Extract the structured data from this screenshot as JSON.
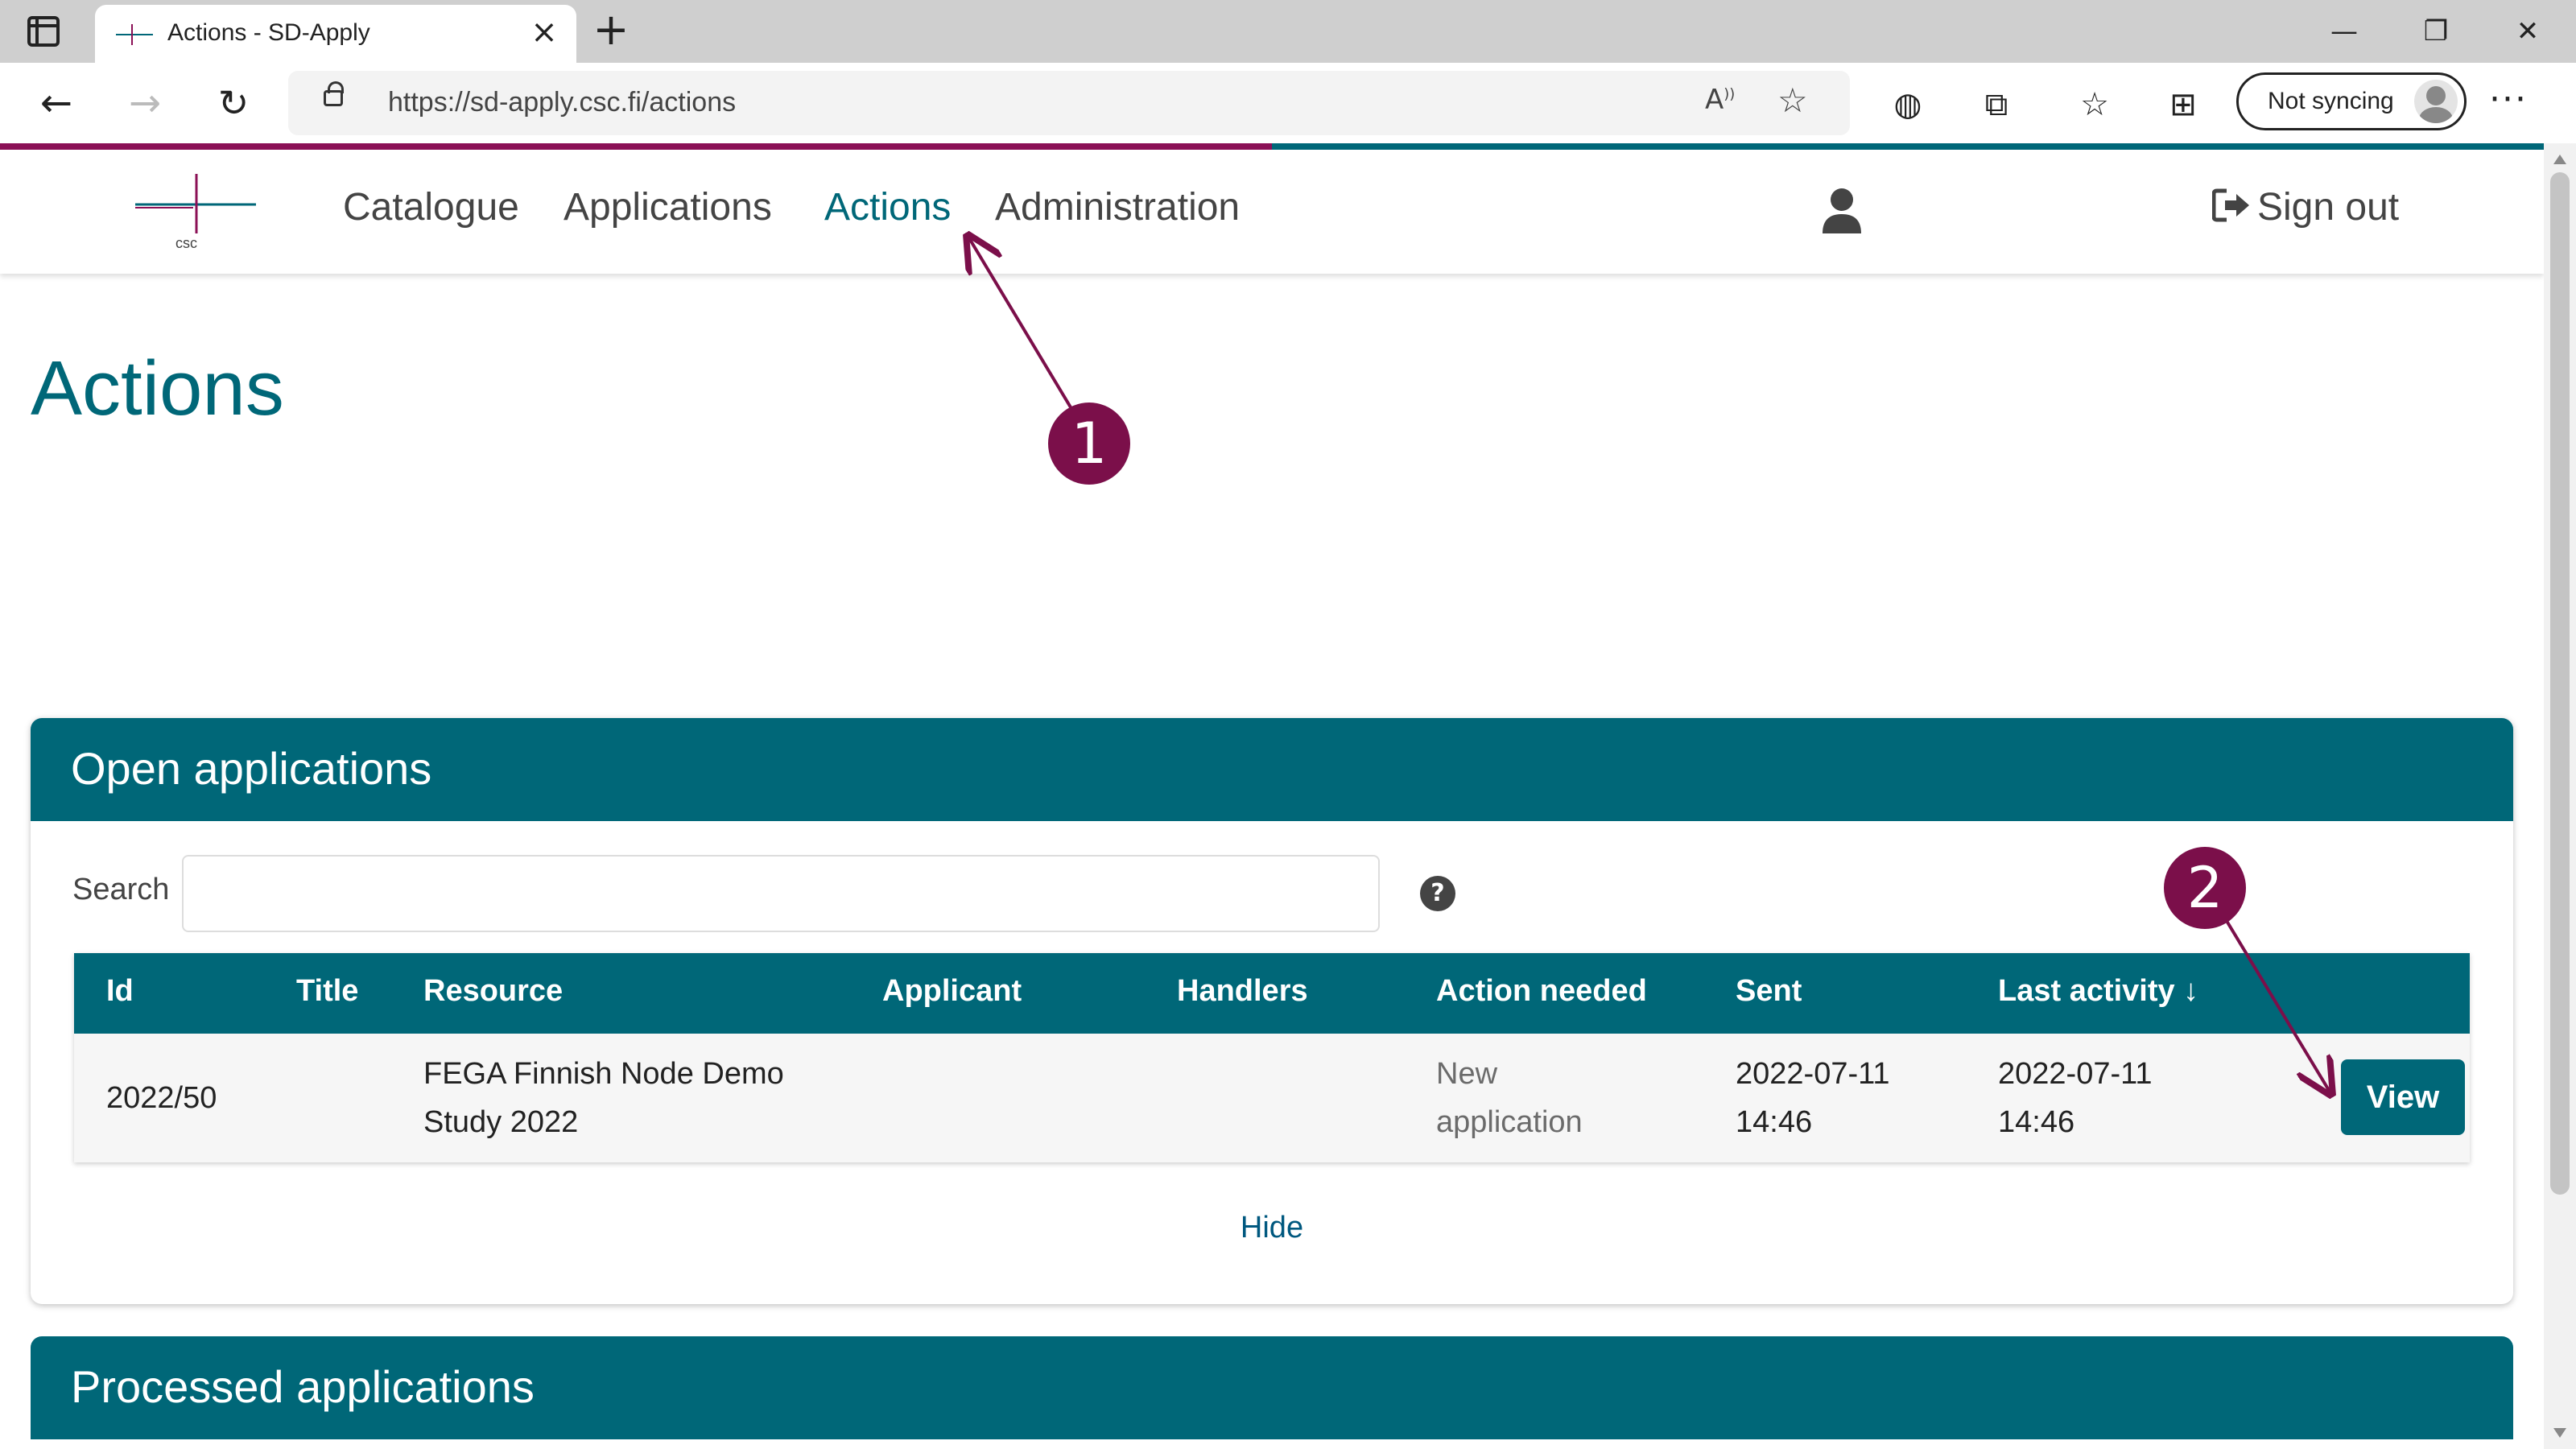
{
  "browser": {
    "tab_title": "Actions - SD-Apply",
    "url": "https://sd-apply.csc.fi/actions",
    "sync_label": "Not syncing",
    "icons": [
      "sidebar-toggle-icon",
      "close-icon",
      "plus-icon",
      "minimize-icon",
      "maximize-icon",
      "close-window-icon",
      "back-icon",
      "forward-icon",
      "reload-icon",
      "lock-icon",
      "read-aloud-icon",
      "add-favorite-icon",
      "globe-icon",
      "extensions-icon",
      "favorites-icon",
      "collections-icon",
      "profile-avatar",
      "more-icon"
    ]
  },
  "site_nav": {
    "logo_text": "csc",
    "links": [
      "Catalogue",
      "Applications",
      "Actions",
      "Administration"
    ],
    "active": "Actions",
    "sign_out": "Sign out",
    "colors": {
      "accent_magenta": "#8b1056",
      "accent_teal": "#006778"
    }
  },
  "page": {
    "title": "Actions"
  },
  "open_applications": {
    "title": "Open applications",
    "search_label": "Search",
    "search_value": "",
    "columns": [
      "Id",
      "Title",
      "Resource",
      "Applicant",
      "Handlers",
      "Action needed",
      "Sent",
      "Last activity"
    ],
    "sort_indicator": "↓",
    "rows": [
      {
        "id": "2022/50",
        "title": "",
        "resource_line1": "FEGA Finnish Node Demo",
        "resource_line2": "Study 2022",
        "applicant": "",
        "handlers": "",
        "action_needed_line1": "New",
        "action_needed_line2": "application",
        "sent_line1": "2022-07-11",
        "sent_line2": "14:46",
        "last_activity_line1": "2022-07-11",
        "last_activity_line2": "14:46",
        "view_label": "View"
      }
    ],
    "hide_label": "Hide"
  },
  "processed_applications": {
    "title": "Processed applications"
  },
  "annotations": {
    "marker_1": "1",
    "marker_2": "2",
    "color": "#7b0f4a"
  }
}
